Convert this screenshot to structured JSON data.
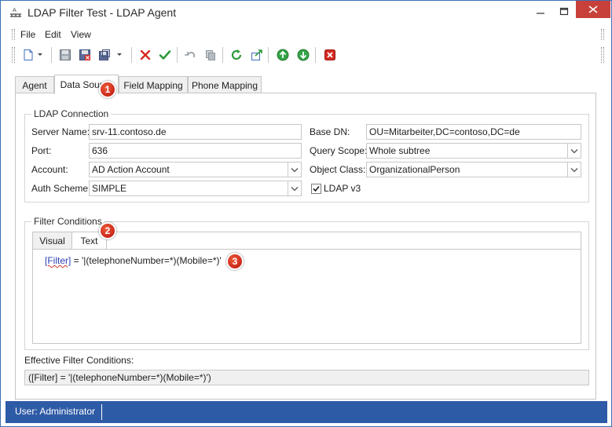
{
  "window": {
    "title": "LDAP Filter Test - LDAP Agent"
  },
  "menu": [
    "File",
    "Edit",
    "View"
  ],
  "toolbar": {
    "buttons": [
      "new-icon",
      "save-icon",
      "save-close-icon",
      "save-as-icon",
      "delete-icon",
      "confirm-icon",
      "undo-icon",
      "copy-icon",
      "refresh-icon",
      "export-icon",
      "up-icon",
      "down-icon",
      "close-record-icon"
    ]
  },
  "tabs": [
    {
      "label": "Agent"
    },
    {
      "label": "Data Source"
    },
    {
      "label": "Field Mapping"
    },
    {
      "label": "Phone Mapping"
    }
  ],
  "ldap_connection": {
    "title": "LDAP Connection",
    "server_name_label": "Server Name:",
    "server_name": "srv-11.contoso.de",
    "port_label": "Port:",
    "port": "636",
    "account_label": "Account:",
    "account": "AD Action Account",
    "auth_scheme_label": "Auth Scheme:",
    "auth_scheme": "SIMPLE",
    "base_dn_label": "Base DN:",
    "base_dn": "OU=Mitarbeiter,DC=contoso,DC=de",
    "query_scope_label": "Query Scope:",
    "query_scope": "Whole subtree",
    "object_class_label": "Object Class:",
    "object_class": "OrganizationalPerson",
    "ldap_v3_label": "LDAP v3",
    "ldap_v3_checked": true
  },
  "filter_conditions": {
    "title": "Filter Conditions",
    "tabs": [
      {
        "label": "Visual"
      },
      {
        "label": "Text"
      }
    ],
    "filter_keyword": "[Filter]",
    "filter_expression": " = '|(telephoneNumber=*)(Mobile=*)'"
  },
  "effective": {
    "label": "Effective Filter Conditions:",
    "value": "([Filter] = '|(telephoneNumber=*)(Mobile=*)')"
  },
  "badges": [
    "1",
    "2",
    "3"
  ],
  "status": {
    "user": "User: Administrator"
  },
  "colors": {
    "accent": "#2e5ba6",
    "close_button": "#c7413a",
    "badge": "#c81e12"
  }
}
